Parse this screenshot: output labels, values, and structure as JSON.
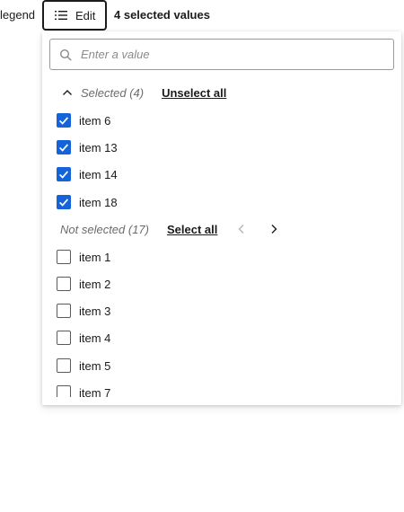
{
  "toolbar": {
    "legend_label": "legend",
    "edit_label": "Edit",
    "edit_icon": "list-icon",
    "selected_summary": "4 selected values"
  },
  "search": {
    "placeholder": "Enter a value",
    "value": "",
    "icon": "search-icon"
  },
  "selected_section": {
    "label": "Selected (4)",
    "action": "Unselect all",
    "icon": "chevron-up-icon",
    "items": [
      {
        "label": "item 6",
        "checked": true
      },
      {
        "label": "item 13",
        "checked": true
      },
      {
        "label": "item 14",
        "checked": true
      },
      {
        "label": "item 18",
        "checked": true
      }
    ]
  },
  "not_selected_section": {
    "label": "Not selected (17)",
    "action": "Select all",
    "prev_icon": "chevron-left-icon",
    "next_icon": "chevron-right-icon",
    "items": [
      {
        "label": "item 1",
        "checked": false
      },
      {
        "label": "item 2",
        "checked": false
      },
      {
        "label": "item 3",
        "checked": false
      },
      {
        "label": "item 4",
        "checked": false
      },
      {
        "label": "item 5",
        "checked": false
      },
      {
        "label": "item 7",
        "checked": false
      }
    ]
  },
  "colors": {
    "checkbox_checked": "#1463d8",
    "text": "#1b1b1b",
    "muted": "#6b6b6b"
  }
}
